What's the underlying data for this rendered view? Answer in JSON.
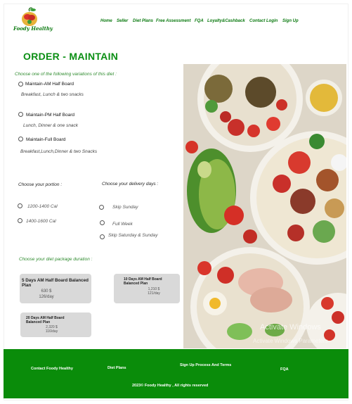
{
  "header": {
    "logo_text": "Foody Healthy",
    "nav": [
      "Home",
      "Seller",
      "Diet Plans",
      "Free Assessment",
      "FQA",
      "Loyalty&Cashback",
      "Contact Login",
      "Sign Up"
    ]
  },
  "page_title": "ORDER - MAINTAIN",
  "variations": {
    "label": "Choose one of the following variations of this diet :",
    "options": [
      {
        "title": "Maintain-AM Half Board",
        "desc": "Breakfast, Lunch & two snacks"
      },
      {
        "title": "Maintain-PM Half Board",
        "desc": "Lunch, Dinner & one snack"
      },
      {
        "title": "Maintain-Full Board",
        "desc": "Breakfast,Lunch,Dinner & two Snacks"
      }
    ]
  },
  "portion": {
    "label": "Choose your portion :",
    "options": [
      "1200-1400 Cal",
      "1400-1600 Cal"
    ]
  },
  "delivery": {
    "label": "Choose your delivery days :",
    "options": [
      "Skip Sunday",
      "Full Week",
      "Skip Saturday & Sunday"
    ]
  },
  "duration": {
    "label": "Choose your diet package duration :",
    "plans": [
      {
        "name": "5 Days AM Half Board Balanced Plan",
        "price": "630 $",
        "per_day": "126/day"
      },
      {
        "name": "10 Days AM Half Board Balanced Plan",
        "price": "1,210 $",
        "per_day": "121/day"
      },
      {
        "name": "20 Days AM Half Board Balanced Plan",
        "price": "2,320 $",
        "per_day": "116/day"
      }
    ]
  },
  "watermark": {
    "line1": "Activate Windows",
    "line2": "Activate Windows Parameters"
  },
  "footer": {
    "contact": "Contact Foody Healthy",
    "diet_plans": "Diet Plans",
    "signup": "Sign Up Process And Terms",
    "fqa": "FQA",
    "copyright": "2023© Foody Healthy , All rights reserved"
  },
  "colors": {
    "brand_green": "#0b7a10",
    "footer_green": "#0a8c0a",
    "card_gray": "#d9d9d9"
  }
}
